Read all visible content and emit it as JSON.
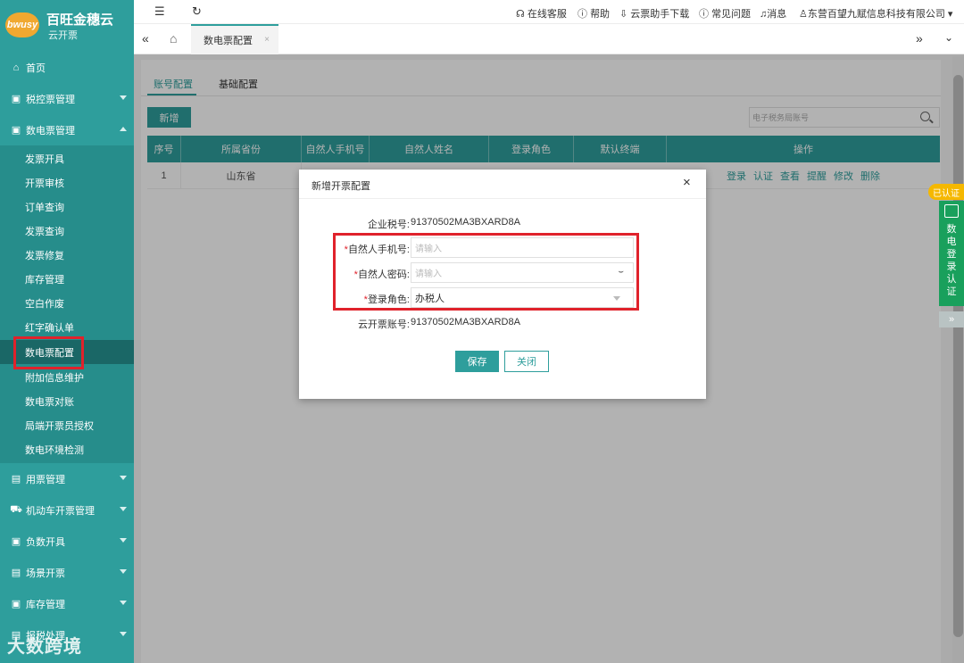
{
  "brand": {
    "badge": "bwusy",
    "title": "百旺金穗云",
    "subtitle": "云开票"
  },
  "sidebar": {
    "top_items": [
      {
        "label": "首页",
        "icon": "home-icon"
      },
      {
        "label": "税控票管理",
        "icon": "tax-icon"
      },
      {
        "label": "数电票管理",
        "icon": "invoice-icon"
      }
    ],
    "sub_items": [
      "发票开具",
      "开票审核",
      "订单查询",
      "发票查询",
      "发票修复",
      "库存管理",
      "空白作废",
      "红字确认单",
      "数电票配置",
      "附加信息维护",
      "数电票对账",
      "局端开票员授权",
      "数电环境检测"
    ],
    "bottom_items": [
      {
        "label": "用票管理",
        "icon": "ticket-icon"
      },
      {
        "label": "机动车开票管理",
        "icon": "car-icon"
      },
      {
        "label": "负数开具",
        "icon": "negative-icon"
      },
      {
        "label": "场景开票",
        "icon": "scene-icon"
      },
      {
        "label": "库存管理",
        "icon": "stock-icon"
      },
      {
        "label": "报税处理",
        "icon": "report-icon"
      }
    ]
  },
  "watermark": "大数跨境",
  "topbar": {
    "links": [
      "在线客服",
      "帮助",
      "云票助手下载",
      "常见问题",
      "消息",
      "东营百望九赋信息科技有限公司"
    ]
  },
  "tabs": {
    "active": "数电票配置",
    "close": "×"
  },
  "page": {
    "inner_tabs": [
      "账号配置",
      "基础配置"
    ],
    "add_button": "新增",
    "search_placeholder": "电子税务局账号",
    "table": {
      "headers": [
        "序号",
        "所属省份",
        "自然人手机号",
        "自然人姓名",
        "登录角色",
        "默认终端",
        "操作"
      ],
      "rows": [
        {
          "index": "1",
          "province": "山东省",
          "actions": [
            "登录",
            "认证",
            "查看",
            "提醒",
            "修改",
            "删除"
          ]
        }
      ]
    }
  },
  "modal": {
    "title": "新增开票配置",
    "close": "×",
    "tax_id_label": "企业税号:",
    "tax_id_value": "91370502MA3BXARD8A",
    "phone_label": "自然人手机号:",
    "phone_placeholder": "请输入",
    "password_label": "自然人密码:",
    "password_placeholder": "请输入",
    "role_label": "登录角色:",
    "role_value": "办税人",
    "account_label": "云开票账号:",
    "account_value": "91370502MA3BXARD8A",
    "required_mark": "*",
    "save": "保存",
    "cancel": "关闭"
  },
  "float_panel": {
    "badge": "已认证",
    "text": "数电登录认证",
    "expand": "»"
  },
  "colors": {
    "primary": "#2e9e9c",
    "highlight": "#e0222b",
    "verify": "#19a05c",
    "badge": "#f5b800"
  }
}
